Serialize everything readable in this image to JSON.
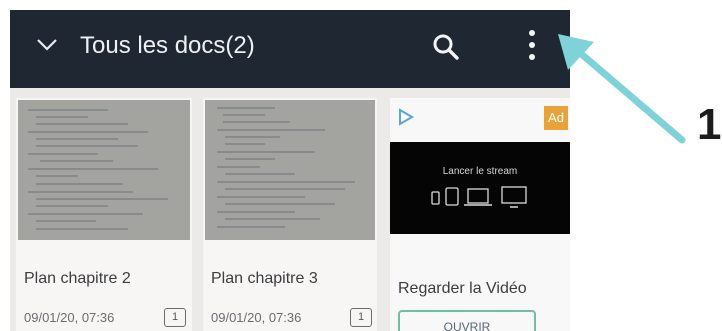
{
  "header": {
    "title": "Tous les docs(2)"
  },
  "documents": [
    {
      "name": "Plan chapitre 2",
      "date": "09/01/20, 07:36",
      "pages": "1"
    },
    {
      "name": "Plan chapitre 3",
      "date": "09/01/20, 07:36",
      "pages": "1"
    }
  ],
  "ad": {
    "badge": "Ad",
    "video_caption": "Lancer le stream",
    "headline": "Regarder la Vidéo",
    "cta": "OUVRIR"
  },
  "annotation": {
    "label": "1",
    "color": "#7fd3d8"
  },
  "colors": {
    "topbar": "#1f2832",
    "accent": "#6cc1a3",
    "ad_badge": "#e7a33a"
  }
}
